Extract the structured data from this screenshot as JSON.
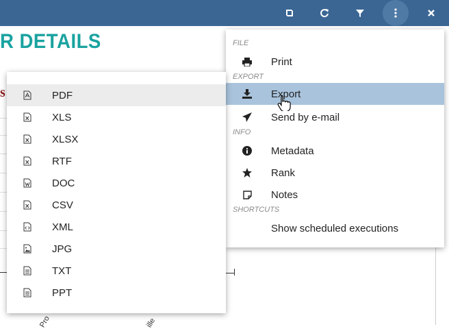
{
  "toolbar": {
    "icons": [
      "book-icon",
      "refresh-icon",
      "filter-icon",
      "more-vertical-icon",
      "close-icon"
    ]
  },
  "report": {
    "title": "R DETAILS",
    "fragment": "s",
    "rotated_labels": [
      "Pro",
      "ille"
    ]
  },
  "main_menu": {
    "sections": {
      "file": "FILE",
      "export": "EXPORT",
      "info": "INFO",
      "shortcuts": "SHORTCUTS"
    },
    "items": {
      "print": "Print",
      "export": "Export",
      "send_email": "Send by e-mail",
      "metadata": "Metadata",
      "rank": "Rank",
      "notes": "Notes",
      "scheduled": "Show scheduled executions"
    }
  },
  "export_menu": {
    "items": [
      "PDF",
      "XLS",
      "XLSX",
      "RTF",
      "DOC",
      "CSV",
      "XML",
      "JPG",
      "TXT",
      "PPT"
    ]
  },
  "colors": {
    "toolbar": "#3b6694",
    "title": "#1aa3a0",
    "highlight": "#a9c3dc"
  }
}
